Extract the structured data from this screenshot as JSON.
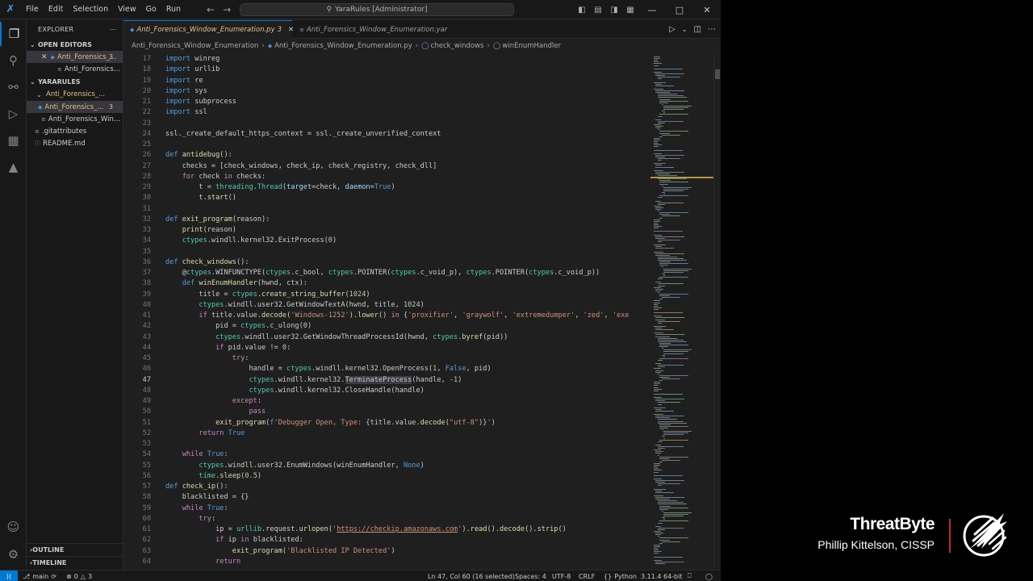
{
  "titlebar": {
    "menu": [
      "File",
      "Edit",
      "Selection",
      "View",
      "Go",
      "Run"
    ],
    "search": "YaraRules [Administrator]"
  },
  "sidebar": {
    "header": "EXPLORER",
    "open_editors_label": "OPEN EDITORS",
    "open_editors": [
      {
        "name": "Anti_Forensics_...",
        "badge": "3"
      },
      {
        "name": "Anti_Forensics_..."
      }
    ],
    "folder_label": "YARARULES",
    "tree": [
      {
        "name": "Anti_Forensics_..."
      },
      {
        "name": "Anti_Forensics_...",
        "badge": "3"
      },
      {
        "name": "Anti_Forensics_Wind..."
      },
      {
        "name": ".gitattributes"
      },
      {
        "name": "README.md"
      }
    ],
    "outline_label": "OUTLINE",
    "timeline_label": "TIMELINE"
  },
  "tabs": [
    {
      "label": "Anti_Forensics_Window_Enumeration.py",
      "badge": "3"
    },
    {
      "label": "Anti_Forensics_Window_Enumeration.yar"
    }
  ],
  "breadcrumb": {
    "folder": "Anti_Forensics_Window_Enumeration",
    "file": "Anti_Forensics_Window_Enumeration.py",
    "fn": "check_windows",
    "inner": "winEnumHandler"
  },
  "status": {
    "branch": "main",
    "errors": "0",
    "warnings": "3",
    "position": "Ln 47, Col 60 (16 selected)",
    "spaces": "Spaces: 4",
    "encoding": "UTF-8",
    "eol": "CRLF",
    "language": "Python",
    "interpreter": "3.11.4 64-bit"
  },
  "brand": {
    "name": "ThreatByte",
    "person": "Phillip Kittelson, CISSP"
  },
  "code": [
    {
      "n": "17",
      "t": [
        [
          "k",
          "import"
        ],
        [
          "p",
          " winreg"
        ]
      ]
    },
    {
      "n": "18",
      "t": [
        [
          "k",
          "import"
        ],
        [
          "p",
          " urllib"
        ]
      ]
    },
    {
      "n": "19",
      "t": [
        [
          "k",
          "import"
        ],
        [
          "p",
          " re"
        ]
      ]
    },
    {
      "n": "20",
      "t": [
        [
          "k",
          "import"
        ],
        [
          "p",
          " sys"
        ]
      ]
    },
    {
      "n": "21",
      "t": [
        [
          "k",
          "import"
        ],
        [
          "p",
          " subprocess"
        ]
      ]
    },
    {
      "n": "22",
      "t": [
        [
          "k",
          "import"
        ],
        [
          "p",
          " ssl"
        ]
      ]
    },
    {
      "n": "23",
      "t": []
    },
    {
      "n": "24",
      "t": [
        [
          "p",
          "ssl._create_default_https_context = ssl._create_unverified_context"
        ]
      ]
    },
    {
      "n": "25",
      "t": []
    },
    {
      "n": "26",
      "t": [
        [
          "k",
          "def"
        ],
        [
          "p",
          " "
        ],
        [
          "f",
          "antidebug"
        ],
        [
          "p",
          "():"
        ]
      ]
    },
    {
      "n": "27",
      "t": [
        [
          "p",
          "    checks = [check_windows, check_ip, check_registry, check_dll]"
        ]
      ]
    },
    {
      "n": "28",
      "t": [
        [
          "p",
          "    "
        ],
        [
          "kc",
          "for"
        ],
        [
          "p",
          " check "
        ],
        [
          "kc",
          "in"
        ],
        [
          "p",
          " checks:"
        ]
      ]
    },
    {
      "n": "29",
      "t": [
        [
          "p",
          "        t = "
        ],
        [
          "c",
          "threading"
        ],
        [
          "p",
          "."
        ],
        [
          "c",
          "Thread"
        ],
        [
          "p",
          "("
        ],
        [
          "v",
          "target"
        ],
        [
          "p",
          "=check, "
        ],
        [
          "v",
          "daemon"
        ],
        [
          "p",
          "="
        ],
        [
          "k",
          "True"
        ],
        [
          "p",
          ")"
        ]
      ]
    },
    {
      "n": "30",
      "t": [
        [
          "p",
          "        t."
        ],
        [
          "f",
          "start"
        ],
        [
          "p",
          "()"
        ]
      ]
    },
    {
      "n": "31",
      "t": []
    },
    {
      "n": "32",
      "t": [
        [
          "k",
          "def"
        ],
        [
          "p",
          " "
        ],
        [
          "f",
          "exit_program"
        ],
        [
          "p",
          "(reason):"
        ]
      ]
    },
    {
      "n": "33",
      "t": [
        [
          "p",
          "    "
        ],
        [
          "f",
          "print"
        ],
        [
          "p",
          "(reason)"
        ]
      ]
    },
    {
      "n": "34",
      "t": [
        [
          "p",
          "    "
        ],
        [
          "c",
          "ctypes"
        ],
        [
          "p",
          ".windll.kernel32.ExitProcess("
        ],
        [
          "n",
          "0"
        ],
        [
          "p",
          ")"
        ]
      ]
    },
    {
      "n": "35",
      "t": []
    },
    {
      "n": "36",
      "t": [
        [
          "k",
          "def"
        ],
        [
          "p",
          " "
        ],
        [
          "f",
          "check_windows"
        ],
        [
          "p",
          "():"
        ]
      ]
    },
    {
      "n": "37",
      "t": [
        [
          "p",
          "    @"
        ],
        [
          "c",
          "ctypes"
        ],
        [
          "p",
          ".WINFUNCTYPE("
        ],
        [
          "c",
          "ctypes"
        ],
        [
          "p",
          ".c_bool, "
        ],
        [
          "c",
          "ctypes"
        ],
        [
          "p",
          ".POINTER("
        ],
        [
          "c",
          "ctypes"
        ],
        [
          "p",
          ".c_void_p), "
        ],
        [
          "c",
          "ctypes"
        ],
        [
          "p",
          ".POINTER("
        ],
        [
          "c",
          "ctypes"
        ],
        [
          "p",
          ".c_void_p))"
        ]
      ]
    },
    {
      "n": "38",
      "t": [
        [
          "p",
          "    "
        ],
        [
          "k",
          "def"
        ],
        [
          "p",
          " "
        ],
        [
          "f",
          "winEnumHandler"
        ],
        [
          "p",
          "(hwnd, ctx):"
        ]
      ]
    },
    {
      "n": "39",
      "t": [
        [
          "p",
          "        title = "
        ],
        [
          "c",
          "ctypes"
        ],
        [
          "p",
          "."
        ],
        [
          "f",
          "create_string_buffer"
        ],
        [
          "p",
          "("
        ],
        [
          "n",
          "1024"
        ],
        [
          "p",
          ")"
        ]
      ]
    },
    {
      "n": "40",
      "t": [
        [
          "p",
          "        "
        ],
        [
          "c",
          "ctypes"
        ],
        [
          "p",
          ".windll.user32.GetWindowTextA(hwnd, title, "
        ],
        [
          "n",
          "1024"
        ],
        [
          "p",
          ")"
        ]
      ]
    },
    {
      "n": "41",
      "t": [
        [
          "p",
          "        "
        ],
        [
          "kc",
          "if"
        ],
        [
          "p",
          " title.value."
        ],
        [
          "f",
          "decode"
        ],
        [
          "p",
          "("
        ],
        [
          "s",
          "'Windows-1252'"
        ],
        [
          "p",
          ")."
        ],
        [
          "f",
          "lower"
        ],
        [
          "p",
          "() "
        ],
        [
          "kc",
          "in"
        ],
        [
          "p",
          " {"
        ],
        [
          "s",
          "'proxifier'"
        ],
        [
          "p",
          ", "
        ],
        [
          "s",
          "'graywolf'"
        ],
        [
          "p",
          ", "
        ],
        [
          "s",
          "'extremedumper'"
        ],
        [
          "p",
          ", "
        ],
        [
          "s",
          "'zed'"
        ],
        [
          "p",
          ", "
        ],
        [
          "s",
          "'exe"
        ]
      ]
    },
    {
      "n": "42",
      "t": [
        [
          "p",
          "            pid = "
        ],
        [
          "c",
          "ctypes"
        ],
        [
          "p",
          ".c_ulong("
        ],
        [
          "n",
          "0"
        ],
        [
          "p",
          ")"
        ]
      ]
    },
    {
      "n": "43",
      "t": [
        [
          "p",
          "            "
        ],
        [
          "c",
          "ctypes"
        ],
        [
          "p",
          ".windll.user32.GetWindowThreadProcessId(hwnd, "
        ],
        [
          "c",
          "ctypes"
        ],
        [
          "p",
          "."
        ],
        [
          "f",
          "byref"
        ],
        [
          "p",
          "(pid))"
        ]
      ]
    },
    {
      "n": "44",
      "t": [
        [
          "p",
          "            "
        ],
        [
          "kc",
          "if"
        ],
        [
          "p",
          " pid.value != "
        ],
        [
          "n",
          "0"
        ],
        [
          "p",
          ":"
        ]
      ]
    },
    {
      "n": "45",
      "t": [
        [
          "p",
          "                "
        ],
        [
          "kc",
          "try"
        ],
        [
          "p",
          ":"
        ]
      ]
    },
    {
      "n": "46",
      "t": [
        [
          "p",
          "                    handle = "
        ],
        [
          "c",
          "ctypes"
        ],
        [
          "p",
          ".windll.kernel32.OpenProcess("
        ],
        [
          "n",
          "1"
        ],
        [
          "p",
          ", "
        ],
        [
          "k",
          "False"
        ],
        [
          "p",
          ", pid)"
        ]
      ]
    },
    {
      "n": "47",
      "t": [
        [
          "p",
          "                    "
        ],
        [
          "c",
          "ctypes"
        ],
        [
          "p",
          ".windll.kernel32."
        ],
        [
          "h",
          "TerminateProcess"
        ],
        [
          "p",
          "(handle, -"
        ],
        [
          "n",
          "1"
        ],
        [
          "p",
          ")"
        ]
      ]
    },
    {
      "n": "48",
      "t": [
        [
          "p",
          "                    "
        ],
        [
          "c",
          "ctypes"
        ],
        [
          "p",
          ".windll.kernel32.CloseHandle(handle)"
        ]
      ]
    },
    {
      "n": "49",
      "t": [
        [
          "p",
          "                "
        ],
        [
          "kc",
          "except"
        ],
        [
          "p",
          ":"
        ]
      ]
    },
    {
      "n": "50",
      "t": [
        [
          "p",
          "                    "
        ],
        [
          "kc",
          "pass"
        ]
      ]
    },
    {
      "n": "51",
      "t": [
        [
          "p",
          "            "
        ],
        [
          "f",
          "exit_program"
        ],
        [
          "p",
          "("
        ],
        [
          "k",
          "f"
        ],
        [
          "s",
          "'Debugger Open, Type: "
        ],
        [
          "p",
          "{title.value."
        ],
        [
          "f",
          "decode"
        ],
        [
          "p",
          "("
        ],
        [
          "s",
          "\"utf-8\""
        ],
        [
          "p",
          ")}"
        ],
        [
          "s",
          "'"
        ],
        [
          "p",
          ")"
        ]
      ]
    },
    {
      "n": "52",
      "t": [
        [
          "p",
          "        "
        ],
        [
          "kc",
          "return"
        ],
        [
          "p",
          " "
        ],
        [
          "k",
          "True"
        ]
      ]
    },
    {
      "n": "53",
      "t": []
    },
    {
      "n": "54",
      "t": [
        [
          "p",
          "    "
        ],
        [
          "kc",
          "while"
        ],
        [
          "p",
          " "
        ],
        [
          "k",
          "True"
        ],
        [
          "p",
          ":"
        ]
      ]
    },
    {
      "n": "55",
      "t": [
        [
          "p",
          "        "
        ],
        [
          "c",
          "ctypes"
        ],
        [
          "p",
          ".windll.user32.EnumWindows(winEnumHandler, "
        ],
        [
          "k",
          "None"
        ],
        [
          "p",
          ")"
        ]
      ]
    },
    {
      "n": "56",
      "t": [
        [
          "p",
          "        "
        ],
        [
          "c",
          "time"
        ],
        [
          "p",
          "."
        ],
        [
          "f",
          "sleep"
        ],
        [
          "p",
          "("
        ],
        [
          "n",
          "0.5"
        ],
        [
          "p",
          ")"
        ]
      ]
    },
    {
      "n": "57",
      "t": [
        [
          "k",
          "def"
        ],
        [
          "p",
          " "
        ],
        [
          "f",
          "check_ip"
        ],
        [
          "p",
          "():"
        ]
      ]
    },
    {
      "n": "58",
      "t": [
        [
          "p",
          "    blacklisted = {}"
        ]
      ]
    },
    {
      "n": "59",
      "t": [
        [
          "p",
          "    "
        ],
        [
          "kc",
          "while"
        ],
        [
          "p",
          " "
        ],
        [
          "k",
          "True"
        ],
        [
          "p",
          ":"
        ]
      ]
    },
    {
      "n": "60",
      "t": [
        [
          "p",
          "        "
        ],
        [
          "kc",
          "try"
        ],
        [
          "p",
          ":"
        ]
      ]
    },
    {
      "n": "61",
      "t": [
        [
          "p",
          "            ip = "
        ],
        [
          "c",
          "urllib"
        ],
        [
          "p",
          ".request."
        ],
        [
          "f",
          "urlopen"
        ],
        [
          "p",
          "("
        ],
        [
          "s",
          "'"
        ],
        [
          "u",
          "https://checkip.amazonaws.com"
        ],
        [
          "s",
          "'"
        ],
        [
          "p",
          ")."
        ],
        [
          "f",
          "read"
        ],
        [
          "p",
          "()."
        ],
        [
          "f",
          "decode"
        ],
        [
          "p",
          "()."
        ],
        [
          "f",
          "strip"
        ],
        [
          "p",
          "()"
        ]
      ]
    },
    {
      "n": "62",
      "t": [
        [
          "p",
          "            "
        ],
        [
          "kc",
          "if"
        ],
        [
          "p",
          " ip "
        ],
        [
          "kc",
          "in"
        ],
        [
          "p",
          " blacklisted:"
        ]
      ]
    },
    {
      "n": "63",
      "t": [
        [
          "p",
          "                "
        ],
        [
          "f",
          "exit_program"
        ],
        [
          "p",
          "("
        ],
        [
          "s",
          "'Blacklisted IP Detected'"
        ],
        [
          "p",
          ")"
        ]
      ]
    },
    {
      "n": "64",
      "t": [
        [
          "p",
          "            "
        ],
        [
          "kc",
          "return"
        ]
      ]
    }
  ]
}
